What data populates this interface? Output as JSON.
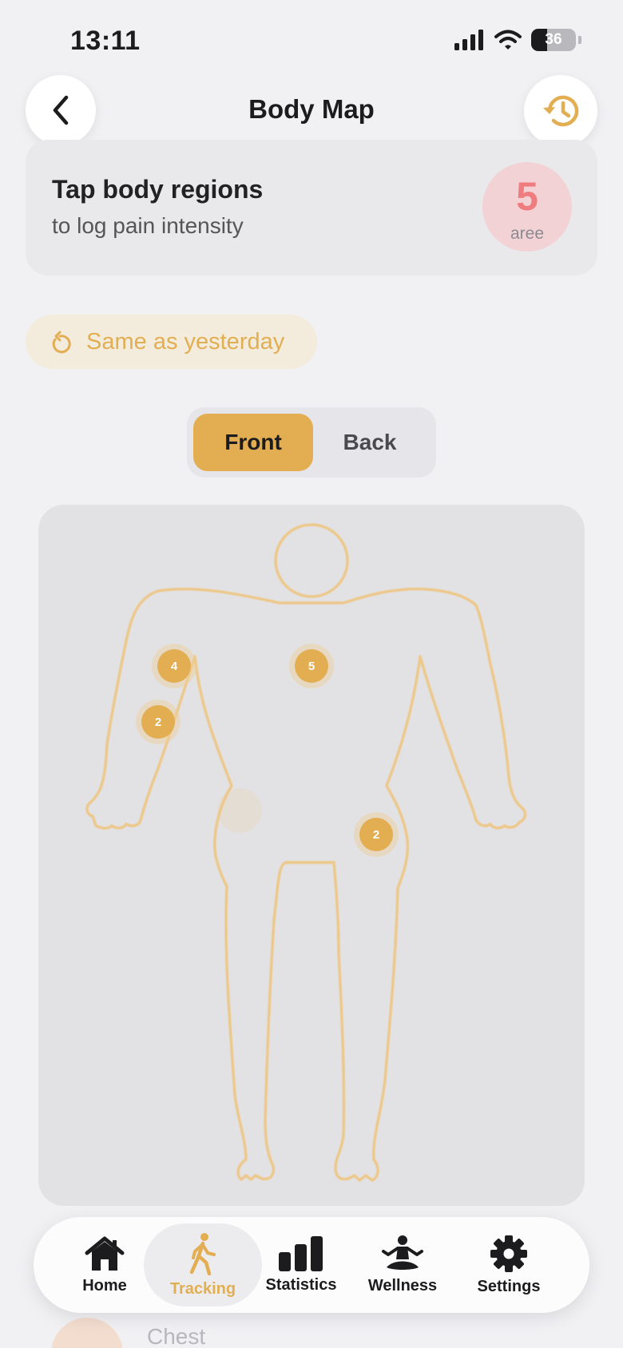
{
  "status_bar": {
    "time": "13:11",
    "battery": "36"
  },
  "header": {
    "title": "Body Map",
    "back_icon": "chevron-left-icon",
    "history_icon": "history-clock-icon"
  },
  "info_card": {
    "title": "Tap body regions",
    "subtitle": "to log pain intensity",
    "count": "5",
    "count_label": "aree"
  },
  "same_as_yesterday": {
    "label": "Same as yesterday",
    "icon": "undo-arrow-icon"
  },
  "view_toggle": {
    "options": [
      "Front",
      "Back"
    ],
    "selected": "Front"
  },
  "body_map": {
    "view": "front",
    "accent_color": "#e3ad52",
    "markers": [
      {
        "region": "right-shoulder",
        "value": "4"
      },
      {
        "region": "chest",
        "value": "5"
      },
      {
        "region": "right-upper-arm",
        "value": "2"
      },
      {
        "region": "left-hip",
        "value": "2"
      }
    ]
  },
  "list_preview": {
    "label": "Chest"
  },
  "tab_bar": {
    "active": "Tracking",
    "tabs": [
      {
        "label": "Home",
        "icon": "house-icon"
      },
      {
        "label": "Tracking",
        "icon": "walking-person-icon"
      },
      {
        "label": "Statistics",
        "icon": "bar-chart-icon"
      },
      {
        "label": "Wellness",
        "icon": "meditation-icon"
      },
      {
        "label": "Settings",
        "icon": "gear-icon"
      }
    ]
  }
}
